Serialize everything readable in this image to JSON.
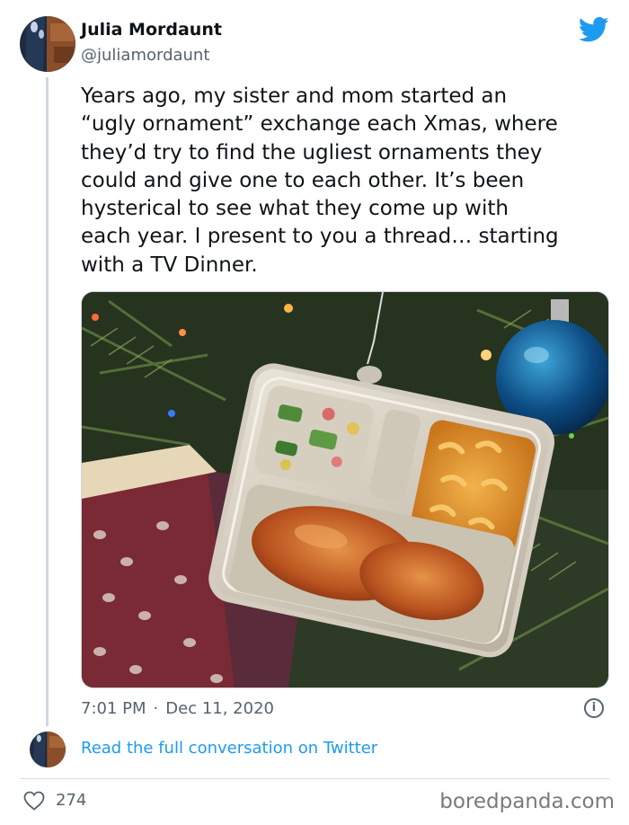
{
  "author": {
    "name": "Julia Mordaunt",
    "handle": "@juliamordaunt"
  },
  "icons": {
    "platform": "twitter-bird-icon",
    "info": "info-icon",
    "like": "heart-icon"
  },
  "tweet": {
    "text": "Years ago, my sister and mom started an\n“ugly ornament” exchange each Xmas, where\nthey’d try to find the ugliest ornaments they\ncould and give one to each other. It’s been\nhysterical to see what they come up with\neach year. I present to you a thread… starting\nwith a TV Dinner.",
    "time": "7:01 PM",
    "separator": "·",
    "date": "Dec 11, 2020",
    "info_glyph": "i"
  },
  "conversation": {
    "link_text": "Read the full conversation on Twitter"
  },
  "engagement": {
    "likes": "274"
  },
  "watermark": "boredpanda.com",
  "colors": {
    "accent": "#1d9bf0",
    "secondary_text": "#536471"
  }
}
